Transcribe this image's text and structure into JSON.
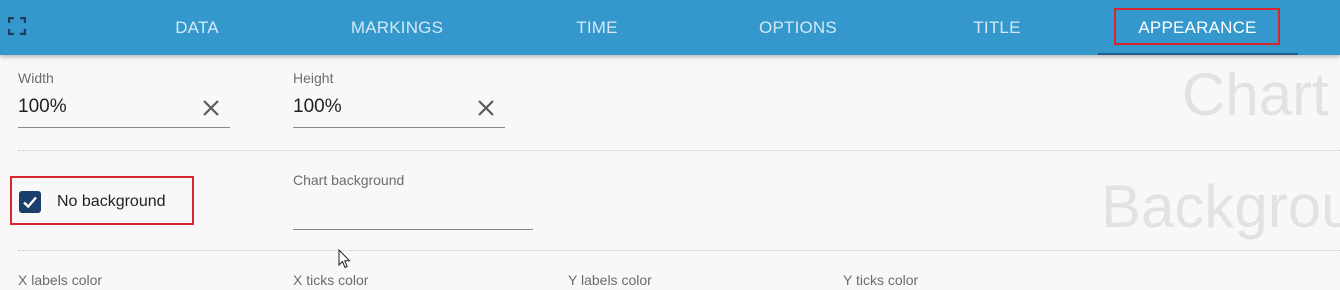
{
  "toolbar": {
    "tabs": [
      {
        "label": "DATA"
      },
      {
        "label": "MARKINGS"
      },
      {
        "label": "TIME"
      },
      {
        "label": "OPTIONS"
      },
      {
        "label": "TITLE"
      },
      {
        "label": "APPEARANCE",
        "active": true
      }
    ],
    "expand_icon": "fullscreen-icon"
  },
  "size": {
    "width_label": "Width",
    "width_value": "100%",
    "height_label": "Height",
    "height_value": "100%",
    "clear_icon": "close-icon"
  },
  "background": {
    "no_background_label": "No background",
    "no_background_checked": true,
    "chart_background_label": "Chart background",
    "chart_background_value": ""
  },
  "colors": {
    "x_labels_color": "X labels color",
    "x_ticks_color": "X ticks color",
    "y_labels_color": "Y labels color",
    "y_ticks_color": "Y ticks color"
  },
  "watermarks": {
    "chart": "Chart",
    "background": "Backgrou"
  },
  "theme": {
    "topbar": "#3598cc",
    "highlight": "#d8262e",
    "checkbox": "#1b3f6b"
  }
}
